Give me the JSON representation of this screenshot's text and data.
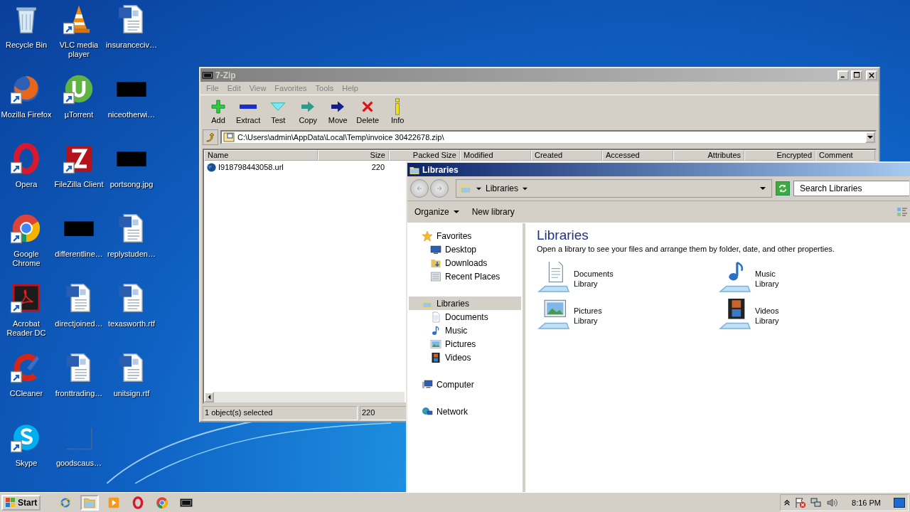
{
  "desktop": {
    "icons": [
      {
        "label": "Recycle Bin",
        "kind": "recycle",
        "shortcut": false
      },
      {
        "label": "Mozilla Firefox",
        "kind": "firefox",
        "shortcut": true
      },
      {
        "label": "Opera",
        "kind": "opera",
        "shortcut": true
      },
      {
        "label": "Google Chrome",
        "kind": "chrome",
        "shortcut": true
      },
      {
        "label": "Acrobat Reader DC",
        "kind": "acrobat",
        "shortcut": true
      },
      {
        "label": "CCleaner",
        "kind": "ccleaner",
        "shortcut": true
      },
      {
        "label": "Skype",
        "kind": "skype",
        "shortcut": true
      },
      {
        "label": "VLC media player",
        "kind": "vlc",
        "shortcut": true
      },
      {
        "label": "µTorrent",
        "kind": "utorrent",
        "shortcut": true
      },
      {
        "label": "FileZilla Client",
        "kind": "filezilla",
        "shortcut": true
      },
      {
        "label": "differentline…",
        "kind": "thumbnail",
        "shortcut": false
      },
      {
        "label": "directjoined…",
        "kind": "word",
        "shortcut": false
      },
      {
        "label": "fronttrading…",
        "kind": "word",
        "shortcut": false
      },
      {
        "label": "goodscaus…",
        "kind": "blank",
        "shortcut": false
      },
      {
        "label": "insuranceciv…",
        "kind": "word",
        "shortcut": false
      },
      {
        "label": "niceotherwi…",
        "kind": "thumbnail",
        "shortcut": false
      },
      {
        "label": "portsong.jpg",
        "kind": "thumbnail",
        "shortcut": false
      },
      {
        "label": "replystuden…",
        "kind": "word",
        "shortcut": false
      },
      {
        "label": "texasworth.rtf",
        "kind": "word",
        "shortcut": false
      },
      {
        "label": "unitsign.rtf",
        "kind": "word",
        "shortcut": false
      }
    ]
  },
  "zip_window": {
    "title": "7-Zip",
    "active": false,
    "menu": [
      "File",
      "Edit",
      "View",
      "Favorites",
      "Tools",
      "Help"
    ],
    "toolbar": [
      {
        "label": "Add",
        "kind": "add"
      },
      {
        "label": "Extract",
        "kind": "extract"
      },
      {
        "label": "Test",
        "kind": "test"
      },
      {
        "label": "Copy",
        "kind": "copy"
      },
      {
        "label": "Move",
        "kind": "move"
      },
      {
        "label": "Delete",
        "kind": "delete"
      },
      {
        "label": "Info",
        "kind": "info"
      }
    ],
    "path": "C:\\Users\\admin\\AppData\\Local\\Temp\\invoice 30422678.zip\\",
    "columns": [
      "Name",
      "Size",
      "Packed Size",
      "Modified",
      "Created",
      "Accessed",
      "Attributes",
      "Encrypted",
      "Comment"
    ],
    "rows": [
      {
        "name": "I918798443058.url",
        "size": "220"
      }
    ],
    "status": [
      "1 object(s) selected",
      "220"
    ]
  },
  "libraries_window": {
    "title": "Libraries",
    "active": true,
    "breadcrumb": "Libraries",
    "search": {
      "placeholder": "Search Libraries"
    },
    "commands": [
      {
        "label": "Organize",
        "dropdown": true
      },
      {
        "label": "New library",
        "dropdown": false
      }
    ],
    "nav": [
      {
        "label": "Favorites",
        "kind": "star",
        "selected": false,
        "children": [
          {
            "label": "Desktop",
            "kind": "monitor",
            "selected": false
          },
          {
            "label": "Downloads",
            "kind": "downloads",
            "selected": false
          },
          {
            "label": "Recent Places",
            "kind": "recent",
            "selected": false
          }
        ]
      },
      {
        "label": "Libraries",
        "kind": "library",
        "selected": true,
        "children": [
          {
            "label": "Documents",
            "kind": "document",
            "selected": false
          },
          {
            "label": "Music",
            "kind": "music",
            "selected": false
          },
          {
            "label": "Pictures",
            "kind": "picture",
            "selected": false
          },
          {
            "label": "Videos",
            "kind": "film",
            "selected": false
          }
        ]
      },
      {
        "label": "Computer",
        "kind": "computer",
        "selected": false
      },
      {
        "label": "Network",
        "kind": "network",
        "selected": false
      }
    ],
    "heading": "Libraries",
    "description": "Open a library to see your files and arrange them by folder, date, and other properties.",
    "libraries": [
      {
        "name": "Documents",
        "type": "Library",
        "kind": "document"
      },
      {
        "name": "Music",
        "type": "Library",
        "kind": "music"
      },
      {
        "name": "Pictures",
        "type": "Library",
        "kind": "picture"
      },
      {
        "name": "Videos",
        "type": "Library",
        "kind": "film"
      }
    ]
  },
  "taskbar": {
    "start": "Start",
    "apps": [
      {
        "kind": "ie",
        "selected": false
      },
      {
        "kind": "explorer",
        "selected": true
      },
      {
        "kind": "player",
        "selected": false
      },
      {
        "kind": "opera",
        "selected": false
      },
      {
        "kind": "chrome",
        "selected": false
      },
      {
        "kind": "sevenzip",
        "selected": false
      }
    ],
    "clock": "8:16 PM"
  }
}
